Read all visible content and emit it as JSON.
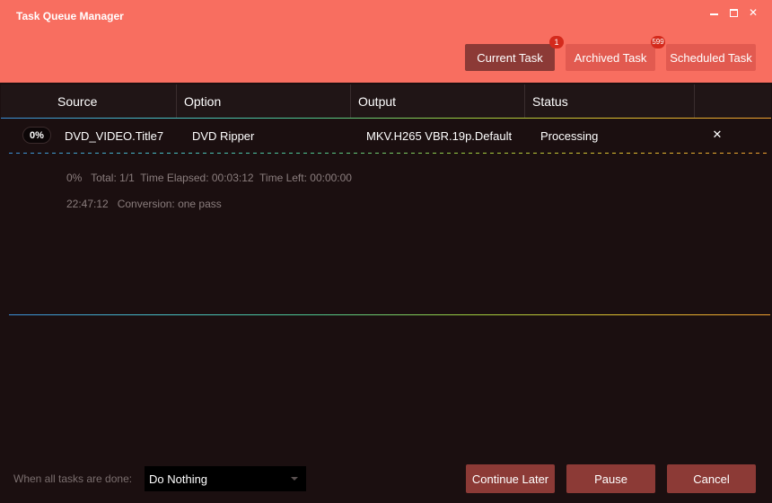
{
  "window": {
    "title": "Task Queue Manager"
  },
  "tabs": [
    {
      "label": "Current Task",
      "badge": "1",
      "active": true
    },
    {
      "label": "Archived Task",
      "badge": "599",
      "active": false
    },
    {
      "label": "Scheduled Task",
      "badge": "",
      "active": false
    }
  ],
  "table": {
    "columns": [
      "Source",
      "Option",
      "Output",
      "Status"
    ],
    "rows": [
      {
        "progress": "0%",
        "source": "DVD_VIDEO.Title7",
        "option": "DVD Ripper",
        "output": "MKV.H265 VBR.19p.Default",
        "status": "Processing",
        "remove": "✕"
      }
    ]
  },
  "details": {
    "line1": "0%   Total: 1/1  Time Elapsed: 00:03:12  Time Left: 00:00:00",
    "line2": "22:47:12   Conversion: one pass"
  },
  "footer": {
    "after_label": "When all tasks are done:",
    "after_value": "Do Nothing",
    "continue_label": "Continue Later",
    "pause_label": "Pause",
    "cancel_label": "Cancel"
  },
  "colors": {
    "header": "#f86e60",
    "active_tab": "#8c3a36",
    "inactive_tab": "#e25a50",
    "badge": "#d42a1c",
    "body": "#1b0f10"
  }
}
